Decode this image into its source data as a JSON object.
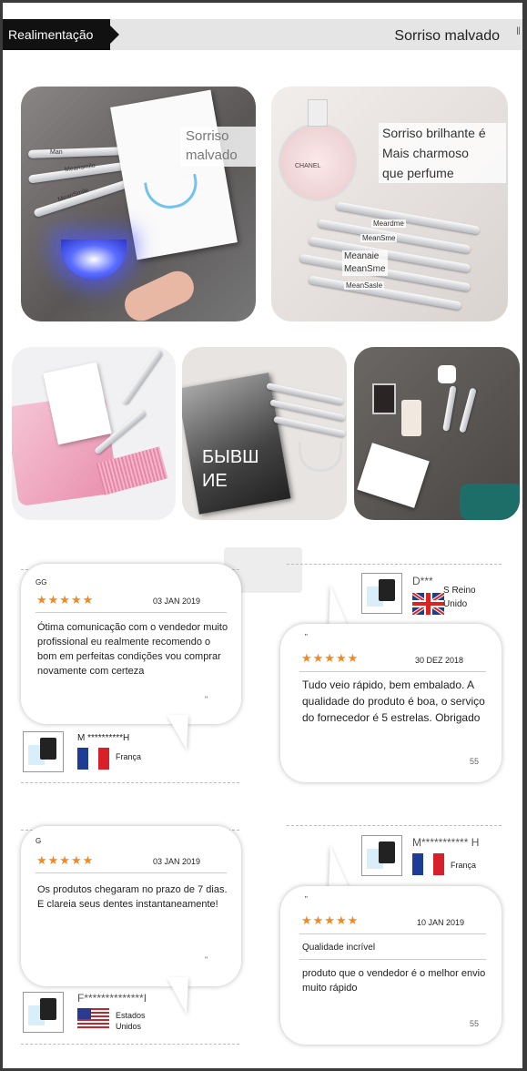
{
  "header": {
    "tag": "Realimentação",
    "title": "Sorriso malvado",
    "extra": "‖"
  },
  "tiles": {
    "t1": {
      "caption": "Sorriso\nmalvado",
      "pens": [
        "Man",
        "Meansmilo",
        "MeanSmile"
      ]
    },
    "t2": {
      "caption": "Sorriso brilhante é\nMais charmoso\nque perfume",
      "bottle": "CHANEL",
      "pen_labels": [
        "Meardme",
        "MeanSme",
        "Meanaie\nMeanSme",
        "MeanSasle"
      ]
    },
    "t4": {
      "caption": "БЫВШ\nИЕ"
    }
  },
  "reviews": [
    {
      "name": "GG",
      "date": "03 JAN 2019",
      "stars": "★★★★★",
      "text": "Ótima comunicação com o vendedor muito profissional eu realmente recomendo o bom em perfeitas condições vou comprar novamente com certeza",
      "quote": "\"",
      "buyer": "M    **********H",
      "country": "França",
      "flag": "fr"
    },
    {
      "name": "\"",
      "date": "30 DEZ 2018",
      "stars": "★★★★★",
      "text": "Tudo veio rápido, bem embalado. A qualidade do produto é boa, o serviço do fornecedor é 5 estrelas.  Obrigado",
      "count": "55",
      "buyer": "D***",
      "country": "S Reino Unido",
      "flag": "uk"
    },
    {
      "name": "G",
      "date": "03 JAN 2019",
      "stars": "★★★★★",
      "text": "Os produtos chegaram no prazo de 7 dias. E clareia seus dentes instantaneamente!",
      "quote": "\"",
      "buyer": "F**************I",
      "country": "Estados Unidos",
      "flag": "us"
    },
    {
      "name": "\"",
      "date": "10 JAN 2019",
      "stars": "★★★★★",
      "title": "Qualidade incrível",
      "text": "produto que o vendedor é o melhor envio muito rápido",
      "count": "55",
      "buyer": "M*********** H",
      "country": "França",
      "flag": "fr"
    }
  ],
  "colors": {
    "star": "#f08a24",
    "thumb_border": "#4ab0d8",
    "header_bg": "#e5e5e5",
    "tag_bg": "#111111"
  }
}
